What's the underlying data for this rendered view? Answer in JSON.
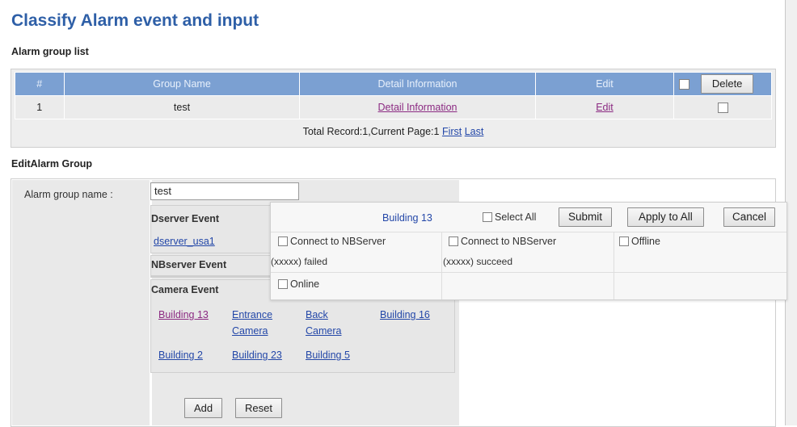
{
  "page": {
    "title": "Classify Alarm event and input"
  },
  "list_section": {
    "heading": "Alarm group list",
    "columns": [
      "#",
      "Group Name",
      "Detail Information",
      "Edit"
    ],
    "delete_label": "Delete",
    "rows": [
      {
        "index": "1",
        "name": "test",
        "detail": "Detail Information",
        "edit": "Edit"
      }
    ],
    "footer_text": "Total Record:1,Current Page:1",
    "first_label": "First",
    "last_label": "Last"
  },
  "edit_section": {
    "heading": "EditAlarm Group",
    "name_label": "Alarm group name :",
    "name_value": "test",
    "dserver": {
      "heading": "Dserver Event",
      "items": [
        "dserver_usa1"
      ]
    },
    "nbserver": {
      "heading": "NBserver Event"
    },
    "camera": {
      "heading": "Camera Event",
      "items": [
        "Building 13",
        "Entrance",
        "Camera",
        "Back",
        "Camera",
        "Building 16",
        "Building 2",
        "Building 23",
        "Building 5"
      ]
    },
    "add_label": "Add",
    "reset_label": "Reset"
  },
  "popup": {
    "title": "Building 13",
    "select_all_label": "Select All",
    "submit_label": "Submit",
    "apply_all_label": "Apply to All",
    "cancel_label": "Cancel",
    "options": [
      {
        "line1": "Connect to NBServer",
        "line2": "(xxxxx) failed"
      },
      {
        "line1": "Connect to NBServer",
        "line2": "(xxxxx) succeed"
      },
      {
        "line1": "Offline",
        "line2": ""
      },
      {
        "line1": "Online",
        "line2": ""
      }
    ]
  },
  "colors": {
    "title": "#2e5fa7",
    "header_bg": "#7ba0d2",
    "link": "#2347a8",
    "visited_link": "#8b2a82"
  }
}
